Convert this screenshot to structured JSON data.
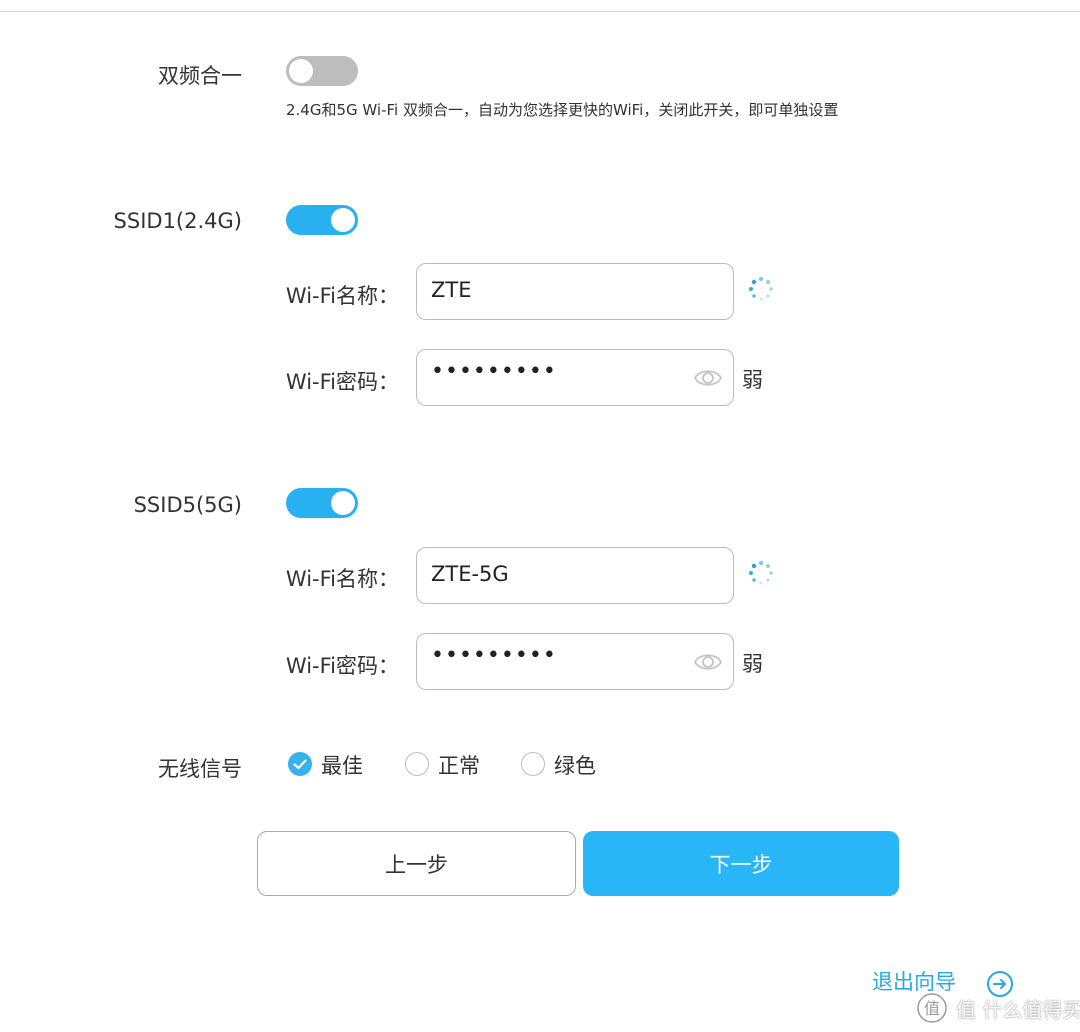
{
  "dual_band": {
    "label": "双频合一",
    "enabled": false,
    "hint": "2.4G和5G Wi-Fi 双频合一，自动为您选择更快的WiFi，关闭此开关，即可单独设置"
  },
  "ssid1": {
    "label": "SSID1(2.4G)",
    "enabled": true,
    "name_label": "Wi-Fi名称：",
    "name_value": "ZTE",
    "password_label": "Wi-Fi密码：",
    "password_value": "•••••••••",
    "strength": "弱"
  },
  "ssid5": {
    "label": "SSID5(5G)",
    "enabled": true,
    "name_label": "Wi-Fi名称：",
    "name_value": "ZTE-5G",
    "password_label": "Wi-Fi密码：",
    "password_value": "•••••••••",
    "strength": "弱"
  },
  "signal": {
    "label": "无线信号",
    "options": [
      {
        "label": "最佳",
        "checked": true
      },
      {
        "label": "正常",
        "checked": false
      },
      {
        "label": "绿色",
        "checked": false
      }
    ]
  },
  "buttons": {
    "prev_label": "上一步",
    "next_label": "下一步"
  },
  "exit": {
    "label": "退出向导"
  },
  "watermark": {
    "text": "值 什么值得买"
  },
  "colors": {
    "accent": "#29b6f6",
    "toggle_on": "#29b0f0",
    "toggle_off": "#bdbdbd",
    "link": "#29a7e6"
  },
  "icons": {
    "eye": "eye-icon",
    "spinner": "loading-icon",
    "exit": "arrow-right-circle-icon",
    "checked": "check-icon"
  }
}
